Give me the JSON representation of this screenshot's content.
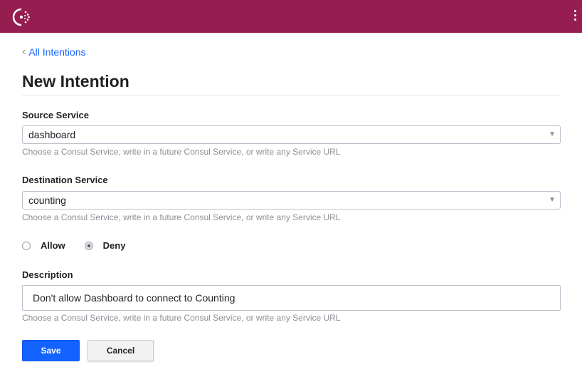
{
  "header": {
    "logo_icon": "consul-logo-icon",
    "menu_icon": "kebab-menu-icon",
    "brand_color": "#961d4f"
  },
  "breadcrumb": {
    "back_label": "All Intentions"
  },
  "page": {
    "title": "New Intention"
  },
  "form": {
    "source": {
      "label": "Source Service",
      "value": "dashboard",
      "help": "Choose a Consul Service, write in a future Consul Service, or write any Service URL"
    },
    "destination": {
      "label": "Destination Service",
      "value": "counting",
      "help": "Choose a Consul Service, write in a future Consul Service, or write any Service URL"
    },
    "action": {
      "options": [
        {
          "label": "Allow",
          "checked": false
        },
        {
          "label": "Deny",
          "checked": true
        }
      ]
    },
    "description": {
      "label": "Description",
      "value": "Don't allow Dashboard to connect to Counting",
      "help": "Choose a Consul Service, write in a future Consul Service, or write any Service URL"
    },
    "buttons": {
      "save": "Save",
      "cancel": "Cancel"
    }
  }
}
